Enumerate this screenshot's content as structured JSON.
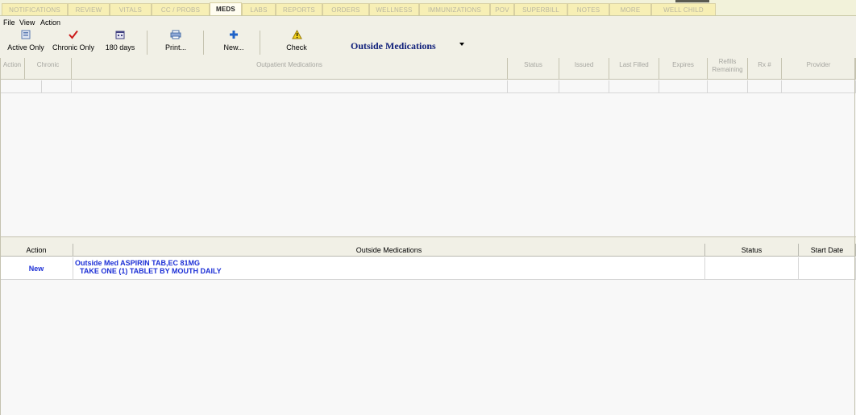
{
  "tabs": [
    "NOTIFICATIONS",
    "REVIEW",
    "VITALS",
    "CC / PROBS",
    "MEDS",
    "LABS",
    "REPORTS",
    "ORDERS",
    "WELLNESS",
    "IMMUNIZATIONS",
    "POV",
    "SUPERBILL",
    "NOTES",
    "MORE",
    "WELL CHILD"
  ],
  "active_tab": "MEDS",
  "menu": {
    "file": "File",
    "view": "View",
    "action": "Action"
  },
  "toolbar": {
    "active_only": "Active Only",
    "chronic_only": "Chronic Only",
    "days_180": "180 days",
    "print": "Print...",
    "new": "New...",
    "check": "Check",
    "panel_select": "Outside Medications"
  },
  "upper_table": {
    "columns": [
      "Action",
      "Chronic",
      "Outpatient Medications",
      "Status",
      "Issued",
      "Last Filled",
      "Expires",
      "Refills Remaining",
      "Rx #",
      "Provider"
    ]
  },
  "lower_table": {
    "columns": [
      "Action",
      "Outside Medications",
      "Status",
      "Start Date"
    ],
    "rows": [
      {
        "action": "New",
        "med_line1": "Outside Med ASPIRIN TAB,EC  81MG",
        "med_line2": "TAKE ONE (1) TABLET BY MOUTH DAILY",
        "status": "",
        "start_date": ""
      }
    ]
  },
  "colors": {
    "accent_blue": "#1c2fd6",
    "title_blue": "#0f1f7a",
    "tab_yellow": "#f7efb5"
  },
  "icons": [
    "list-icon",
    "checkmark-icon",
    "calendar-icon",
    "printer-icon",
    "plus-icon",
    "warning-icon"
  ]
}
